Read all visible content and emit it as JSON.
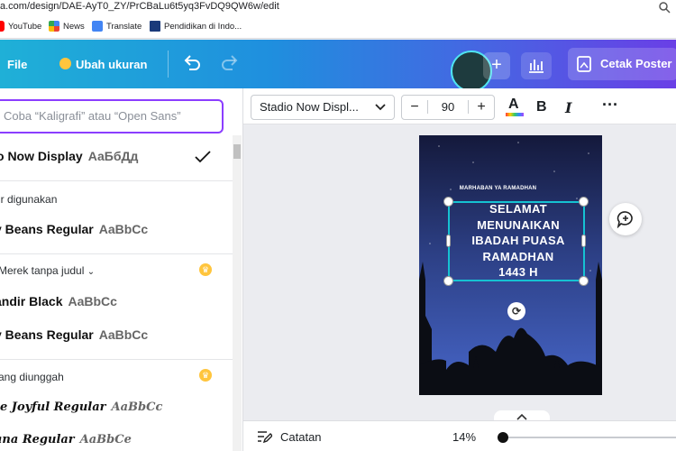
{
  "browser": {
    "url": "a.com/design/DAE-AyT0_ZY/PrCBaLu6t5yq3FvDQ9QW6w/edit",
    "bookmarks": [
      {
        "label": "YouTube",
        "icon": "youtube-icon"
      },
      {
        "label": "News",
        "icon": "news-icon"
      },
      {
        "label": "Translate",
        "icon": "translate-icon"
      },
      {
        "label": "Pendidikan di Indo...",
        "icon": "bookmark-site-icon"
      }
    ]
  },
  "topbar": {
    "file_label": "File",
    "resize_label": "Ubah ukuran",
    "print_label": "Cetak Poster",
    "undo_icon": "undo-icon",
    "redo_icon": "redo-icon"
  },
  "font_panel": {
    "search_placeholder": "Coba “Kaligrafi” atau “Open Sans”",
    "current_font": "o Now Display",
    "current_sample": "АаБбДд",
    "recent_heading": "ir digunakan",
    "recent_fonts": [
      {
        "name": "y Beans Regular",
        "sample": "AaBbCc"
      }
    ],
    "brand_heading": "Merek tanpa judul",
    "brand_fonts": [
      {
        "name": "andir Black",
        "sample": "AaBbCc"
      },
      {
        "name": "y Beans Regular",
        "sample": "AaBbCc"
      }
    ],
    "uploaded_heading": "ang diunggah",
    "uploaded_fonts": [
      {
        "name": "te Joyful Regular",
        "sample": "AaBbCc"
      },
      {
        "name": "ana Regular",
        "sample": "AaBbCe"
      }
    ]
  },
  "editor_toolbar": {
    "font_name": "Stadio Now Displ...",
    "font_size": "90",
    "minus": "−",
    "plus": "+",
    "bold": "B",
    "italic": "I",
    "more": "···"
  },
  "poster": {
    "subtitle": "MARHABAN YA RAMADHAN",
    "title_lines": [
      "SELAMAT",
      "MENUNAIKAN",
      "IBADAH PUASA",
      "RAMADHAN",
      "1443 H"
    ]
  },
  "bottombar": {
    "notes_label": "Catatan",
    "zoom": "14%"
  },
  "colors": {
    "accent": "#8b3dff",
    "selection": "#16c2d2"
  }
}
